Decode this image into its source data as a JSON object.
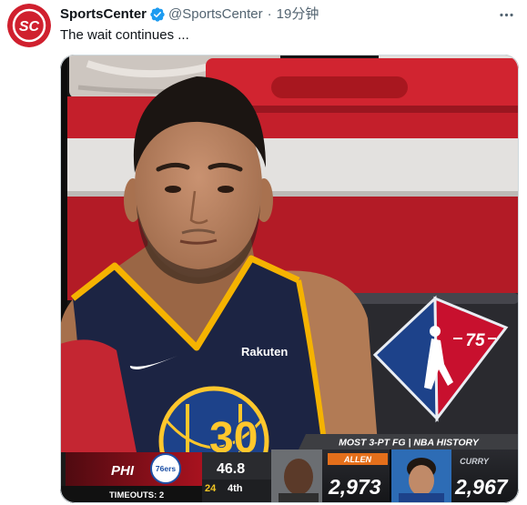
{
  "tweet": {
    "avatar_label": "SC",
    "author_name": "SportsCenter",
    "handle": "@SportsCenter",
    "separator": "·",
    "time": "19分钟",
    "text": "The wait continues ..."
  },
  "icons": {
    "avatar": "sportscenter-logo",
    "verified": "verified-badge-icon",
    "more": "more-horizontal-icon",
    "jersey_brand": "nike-swoosh-icon",
    "jersey_logo": "warriors-bridge-logo",
    "team_logo": "76ers-logo",
    "bench_logo": "nba-75-logo"
  },
  "colors": {
    "brand_red": "#d0202e",
    "verified_blue": "#1d9bf0",
    "text_primary": "#0f1419",
    "text_secondary": "#536471",
    "jersey_navy": "#1c2443",
    "jersey_gold": "#ffc72c",
    "label_orange": "#e46f1b"
  },
  "media": {
    "jersey": {
      "sponsor": "Rakuten",
      "number": "30"
    },
    "bench_logo": {
      "label": "75"
    },
    "team_logo": {
      "label": "76ers"
    },
    "scoreboard": {
      "team": "PHI",
      "timeouts": "TIMEOUTS: 2",
      "game_clock": "46.8",
      "shot_clock": "24",
      "period": "4th",
      "stat_title": "MOST 3-PT FG | NBA HISTORY",
      "leaders": [
        {
          "name": "ALLEN",
          "value": "2,973"
        },
        {
          "name": "CURRY",
          "value": "2,967"
        }
      ]
    }
  }
}
